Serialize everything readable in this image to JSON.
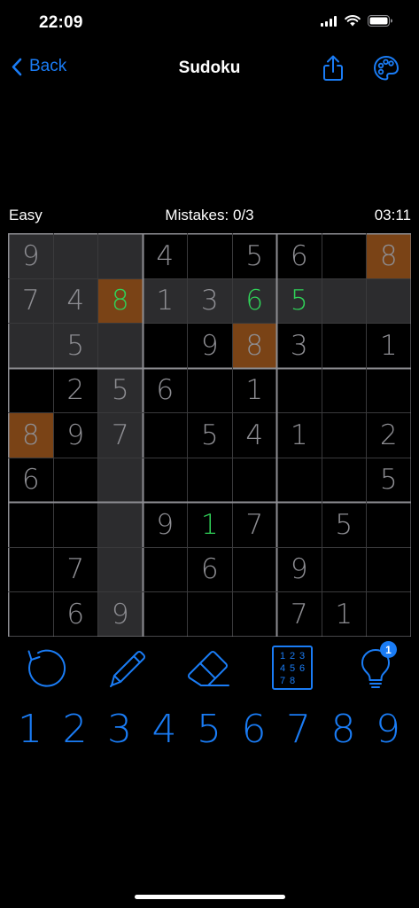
{
  "status_bar": {
    "time": "22:09"
  },
  "nav": {
    "back_label": "Back",
    "title": "Sudoku"
  },
  "info": {
    "difficulty": "Easy",
    "mistakes": "Mistakes: 0/3",
    "timer": "03:11"
  },
  "board": {
    "rows": [
      [
        "9",
        "",
        "",
        "4",
        "",
        "5",
        "6",
        "",
        "8"
      ],
      [
        "7",
        "4",
        "8",
        "1",
        "3",
        "6",
        "5",
        "",
        ""
      ],
      [
        "",
        "5",
        "",
        "",
        "9",
        "8",
        "3",
        "",
        "1"
      ],
      [
        "",
        "2",
        "5",
        "6",
        "",
        "1",
        "",
        "",
        ""
      ],
      [
        "8",
        "9",
        "7",
        "",
        "5",
        "4",
        "1",
        "",
        "2"
      ],
      [
        "6",
        "",
        "",
        "",
        "",
        "",
        "",
        "",
        "5"
      ],
      [
        "",
        "",
        "",
        "9",
        "1",
        "7",
        "",
        "5",
        ""
      ],
      [
        "",
        "7",
        "",
        "",
        "6",
        "",
        "9",
        "",
        ""
      ],
      [
        "",
        "6",
        "9",
        "",
        "",
        "",
        "7",
        "1",
        ""
      ]
    ],
    "highlight": [
      [
        1,
        1,
        1,
        0,
        0,
        0,
        0,
        0,
        0
      ],
      [
        1,
        1,
        1,
        1,
        1,
        1,
        1,
        1,
        1
      ],
      [
        1,
        1,
        1,
        0,
        0,
        0,
        0,
        0,
        0
      ],
      [
        0,
        0,
        1,
        0,
        0,
        0,
        0,
        0,
        0
      ],
      [
        0,
        0,
        1,
        0,
        0,
        0,
        0,
        0,
        0
      ],
      [
        0,
        0,
        1,
        0,
        0,
        0,
        0,
        0,
        0
      ],
      [
        0,
        0,
        1,
        0,
        0,
        0,
        0,
        0,
        0
      ],
      [
        0,
        0,
        1,
        0,
        0,
        0,
        0,
        0,
        0
      ],
      [
        0,
        0,
        1,
        0,
        0,
        0,
        0,
        0,
        0
      ]
    ],
    "same_number": [
      [
        0,
        8
      ],
      [
        1,
        2
      ],
      [
        2,
        5
      ],
      [
        4,
        0
      ]
    ],
    "user_entered": [
      [
        1,
        2
      ],
      [
        1,
        5
      ],
      [
        1,
        6
      ],
      [
        6,
        4
      ]
    ]
  },
  "tools": [
    {
      "name": "undo-button",
      "icon": "undo-icon"
    },
    {
      "name": "pencil-button",
      "icon": "pencil-icon"
    },
    {
      "name": "erase-button",
      "icon": "eraser-icon"
    },
    {
      "name": "auto-notes-button",
      "icon": "notes-grid-icon",
      "grid_labels": [
        "1",
        "2",
        "3",
        "4",
        "5",
        "6",
        "7",
        "8"
      ]
    },
    {
      "name": "hint-button",
      "icon": "lightbulb-icon",
      "badge": "1"
    }
  ],
  "numpad": [
    "1",
    "2",
    "3",
    "4",
    "5",
    "6",
    "7",
    "8",
    "9"
  ],
  "colors": {
    "accent": "#1a7cf5",
    "given_digit": "#8e8e93",
    "user_digit": "#30d158",
    "highlight_cell": "#2c2c2e",
    "same_number_cell": "#7a4316"
  }
}
